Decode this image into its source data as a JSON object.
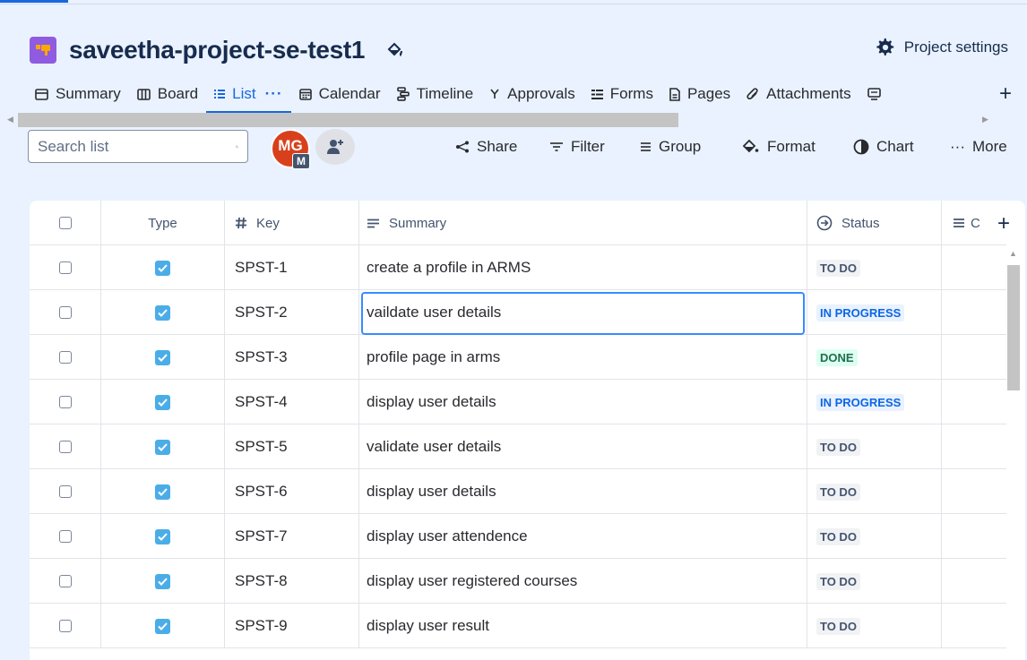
{
  "project": {
    "title": "saveetha-project-se-test1",
    "settings_label": "Project settings"
  },
  "tabs": [
    {
      "label": "Summary",
      "icon": "summary-icon"
    },
    {
      "label": "Board",
      "icon": "board-icon"
    },
    {
      "label": "List",
      "icon": "list-icon",
      "active": true,
      "more": "···"
    },
    {
      "label": "Calendar",
      "icon": "calendar-icon"
    },
    {
      "label": "Timeline",
      "icon": "timeline-icon"
    },
    {
      "label": "Approvals",
      "icon": "approvals-icon"
    },
    {
      "label": "Forms",
      "icon": "forms-icon"
    },
    {
      "label": "Pages",
      "icon": "pages-icon"
    },
    {
      "label": "Attachments",
      "icon": "attachments-icon"
    }
  ],
  "toolbar": {
    "search_placeholder": "Search list",
    "avatar_initials": "MG",
    "avatar_badge": "M",
    "share": "Share",
    "filter": "Filter",
    "group": "Group",
    "format": "Format",
    "chart": "Chart",
    "more": "More",
    "more_dots": "···"
  },
  "table": {
    "headers": {
      "type": "Type",
      "key": "Key",
      "summary": "Summary",
      "status": "Status",
      "extra": "C"
    },
    "rows": [
      {
        "key": "SPST-1",
        "summary": "create a profile in ARMS",
        "status": "TO DO",
        "status_kind": "todo"
      },
      {
        "key": "SPST-2",
        "summary": "vaildate user details",
        "status": "IN PROGRESS",
        "status_kind": "progress",
        "focused": true
      },
      {
        "key": "SPST-3",
        "summary": "profile page in arms",
        "status": "DONE",
        "status_kind": "done"
      },
      {
        "key": "SPST-4",
        "summary": "display user details",
        "status": "IN PROGRESS",
        "status_kind": "progress"
      },
      {
        "key": "SPST-5",
        "summary": "validate user details",
        "status": "TO DO",
        "status_kind": "todo"
      },
      {
        "key": "SPST-6",
        "summary": "display user details",
        "status": "TO DO",
        "status_kind": "todo"
      },
      {
        "key": "SPST-7",
        "summary": "display user attendence",
        "status": "TO DO",
        "status_kind": "todo"
      },
      {
        "key": "SPST-8",
        "summary": "display user registered courses",
        "status": "TO DO",
        "status_kind": "todo"
      },
      {
        "key": "SPST-9",
        "summary": "display user result",
        "status": "TO DO",
        "status_kind": "todo"
      }
    ]
  },
  "colors": {
    "accent": "#1868db",
    "background": "#e9f2fe",
    "type_task": "#4bade8"
  }
}
